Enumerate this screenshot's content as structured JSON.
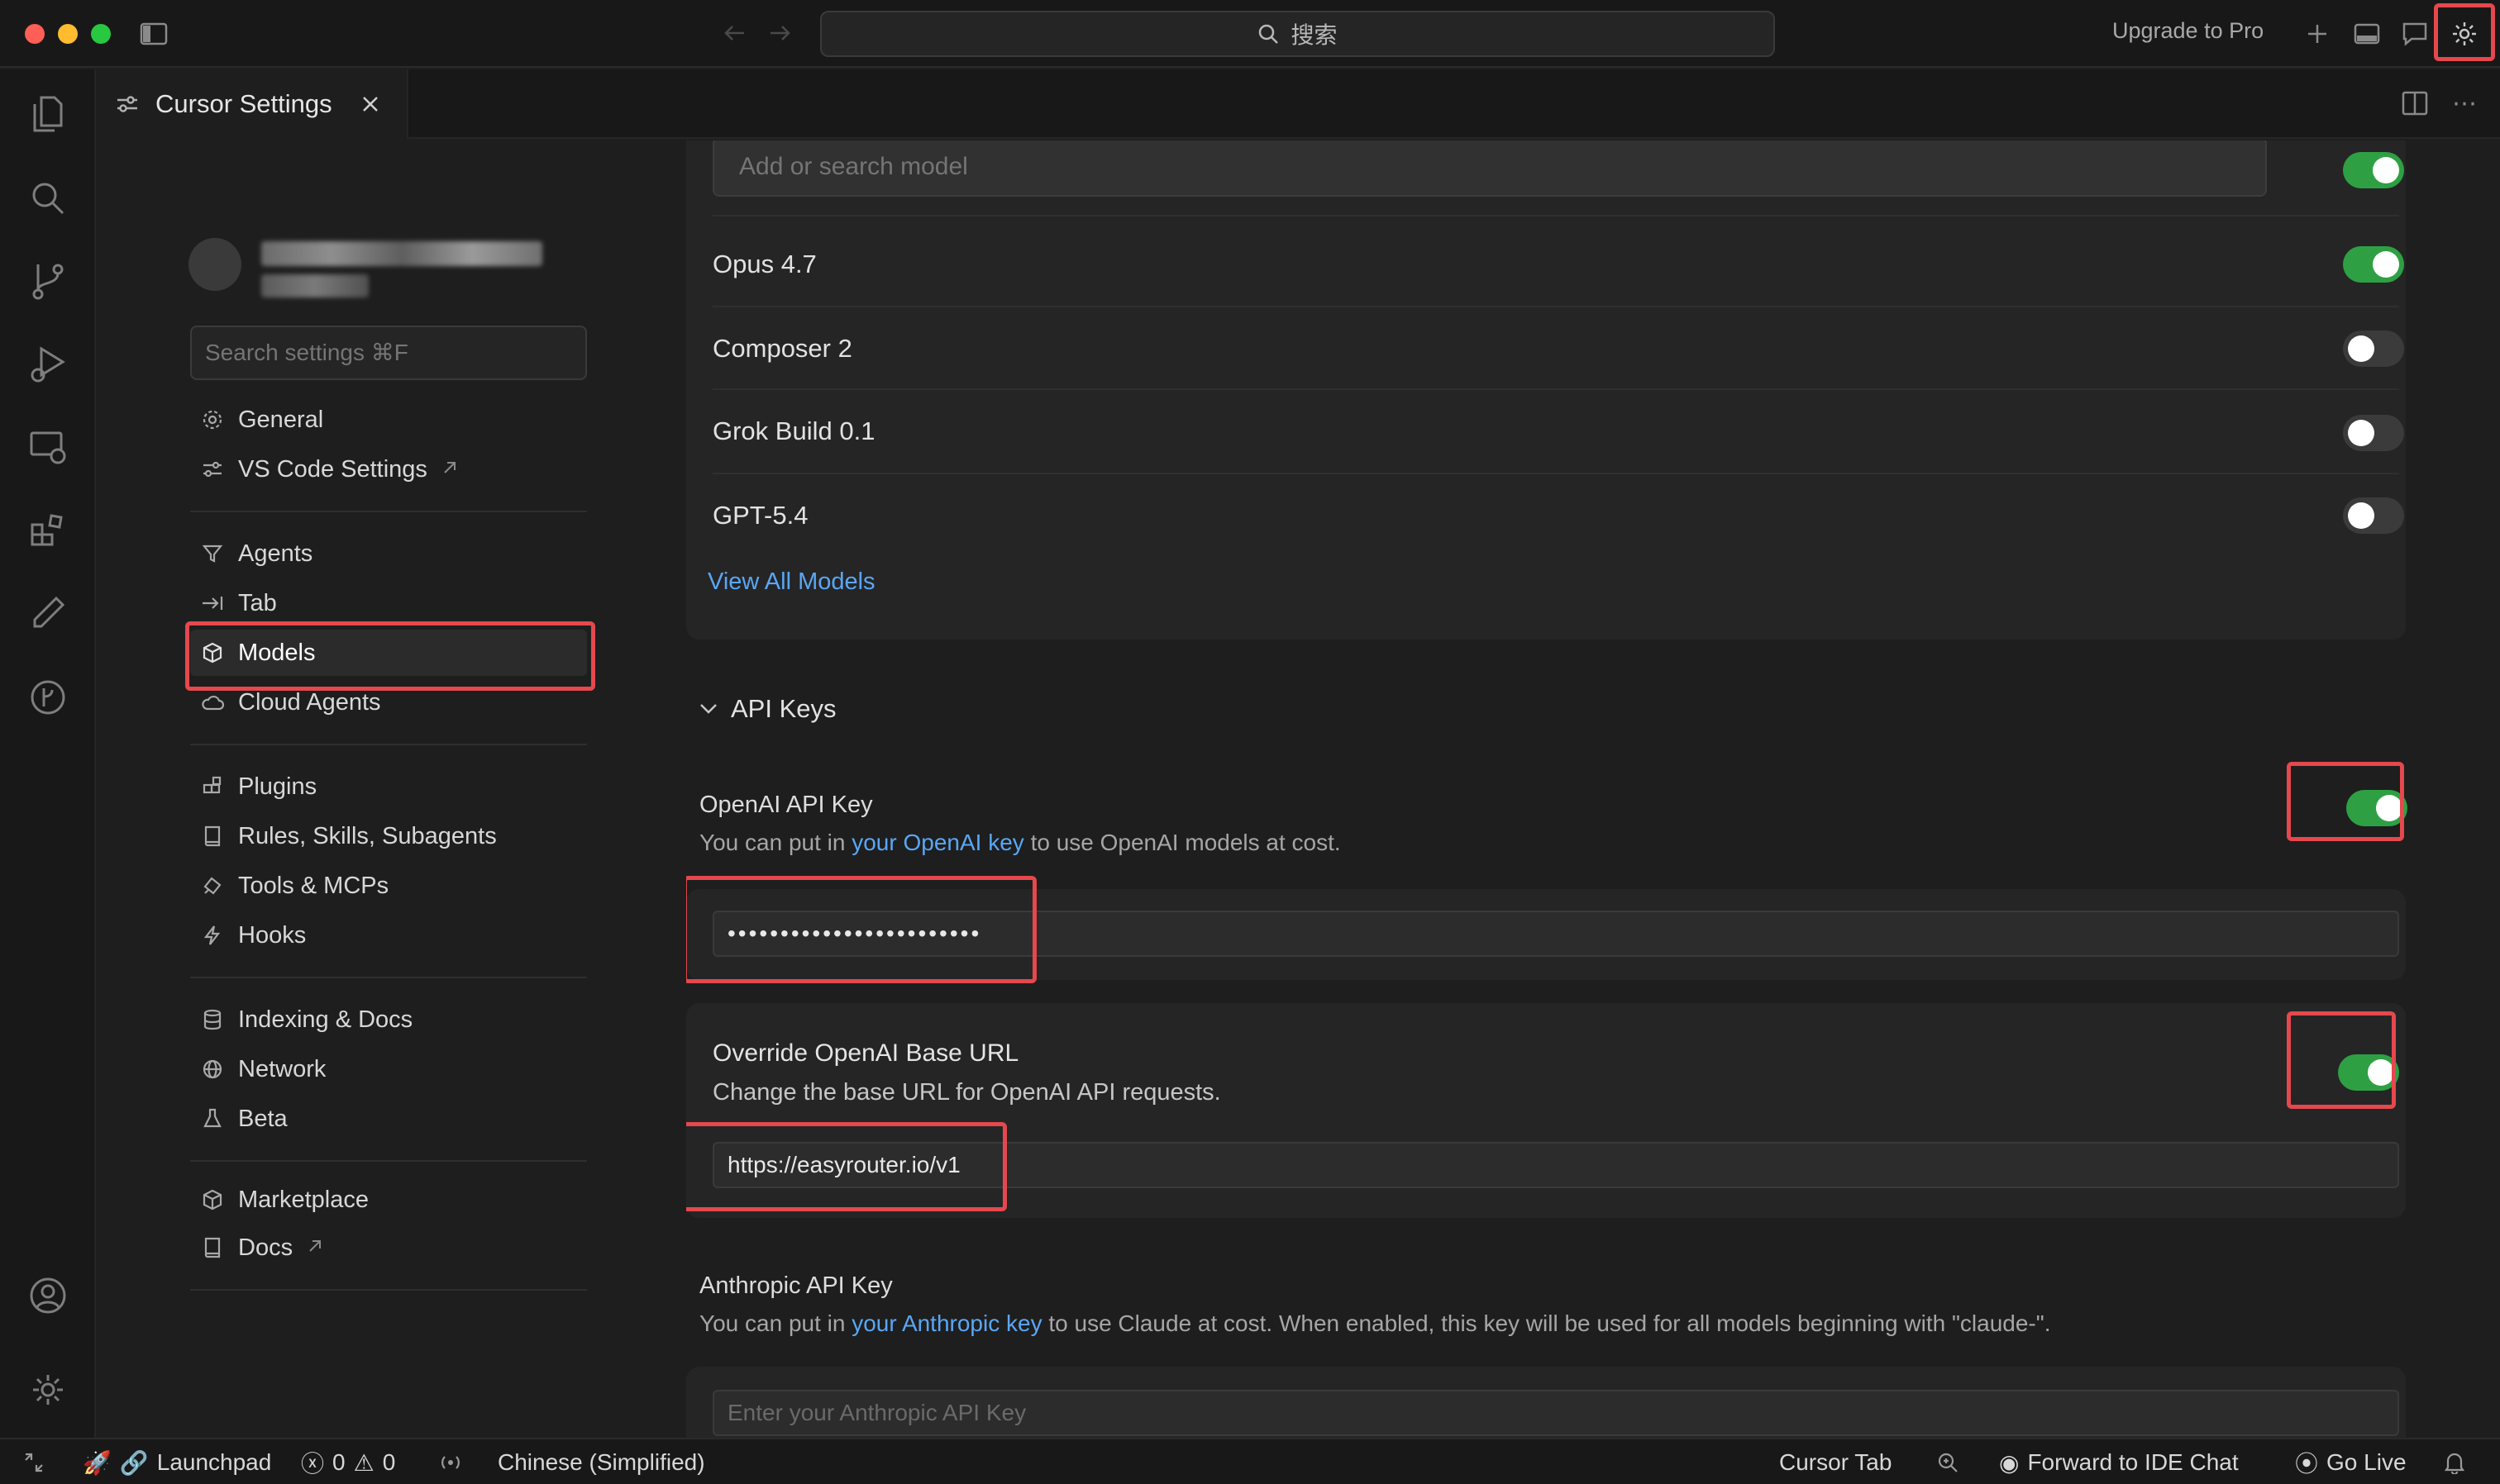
{
  "titlebar": {
    "search_text": "搜索",
    "upgrade_label": "Upgrade to Pro"
  },
  "tab": {
    "title": "Cursor Settings"
  },
  "sidebar": {
    "search_placeholder": "Search settings ⌘F",
    "groups": [
      [
        {
          "label": "General",
          "icon": "gear-icon"
        },
        {
          "label": "VS Code Settings",
          "icon": "sliders-icon",
          "external": true
        }
      ],
      [
        {
          "label": "Agents",
          "icon": "funnel-icon"
        },
        {
          "label": "Tab",
          "icon": "tab-arrow-icon"
        },
        {
          "label": "Models",
          "icon": "cube-icon",
          "active": true
        },
        {
          "label": "Cloud Agents",
          "icon": "cloud-icon"
        }
      ],
      [
        {
          "label": "Plugins",
          "icon": "puzzle-icon"
        },
        {
          "label": "Rules, Skills, Subagents",
          "icon": "book-icon"
        },
        {
          "label": "Tools & MCPs",
          "icon": "tools-icon"
        },
        {
          "label": "Hooks",
          "icon": "bolt-icon"
        }
      ],
      [
        {
          "label": "Indexing & Docs",
          "icon": "database-icon"
        },
        {
          "label": "Network",
          "icon": "globe-icon"
        },
        {
          "label": "Beta",
          "icon": "flask-icon"
        }
      ],
      [
        {
          "label": "Marketplace",
          "icon": "cube-icon"
        },
        {
          "label": "Docs",
          "icon": "book-icon",
          "external": true
        }
      ]
    ]
  },
  "models": {
    "search_placeholder": "Add or search model",
    "items": [
      {
        "name": "Opus 4.7",
        "enabled": true
      },
      {
        "name": "Composer 2",
        "enabled": false
      },
      {
        "name": "Grok Build 0.1",
        "enabled": false
      },
      {
        "name": "GPT-5.4",
        "enabled": false
      }
    ],
    "view_all": "View All Models"
  },
  "api_keys": {
    "section_title": "API Keys",
    "openai": {
      "title": "OpenAI API Key",
      "desc_prefix": "You can put in",
      "desc_link": "your OpenAI key",
      "desc_suffix": "to use OpenAI models at cost.",
      "value": "••••••••••••••••••••••••",
      "enabled": true
    },
    "override": {
      "title": "Override OpenAI Base URL",
      "desc": "Change the base URL for OpenAI API requests.",
      "value": "https://easyrouter.io/v1",
      "enabled": true
    },
    "anthropic": {
      "title": "Anthropic API Key",
      "desc_prefix": "You can put in",
      "desc_link": "your Anthropic key",
      "desc_suffix": "to use Claude at cost. When enabled, this key will be used for all models beginning with \"claude-\".",
      "placeholder": "Enter your Anthropic API Key"
    }
  },
  "statusbar": {
    "launchpad": "Launchpad",
    "errors": "0",
    "warnings": "0",
    "language": "Chinese (Simplified)",
    "cursor_tab": "Cursor Tab",
    "forward": "Forward to IDE Chat",
    "go_live": "Go Live"
  },
  "colors": {
    "toggle_on": "#2ea043",
    "link": "#5aa7f5",
    "highlight": "#e5484d"
  }
}
